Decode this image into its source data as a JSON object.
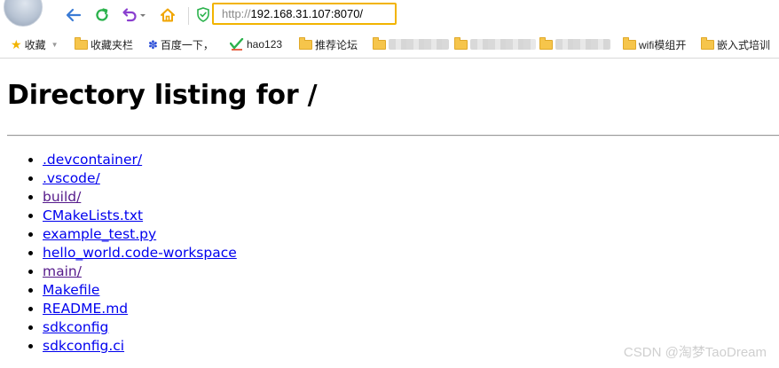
{
  "toolbar": {
    "url_scheme": "http://",
    "url_host": "192.168.31.107:8070/"
  },
  "bookmarks": {
    "items": [
      {
        "label": "收藏",
        "icon": "star-icon"
      },
      {
        "label": "收藏夹栏",
        "icon": "folder-icon"
      },
      {
        "label": "百度一下，",
        "icon": "baidu-paw-icon"
      },
      {
        "label": "hao123",
        "icon": "hao123-icon"
      },
      {
        "label": "推荐论坛",
        "icon": "folder-icon"
      },
      {
        "label": "",
        "icon": "folder-icon"
      },
      {
        "label": "",
        "icon": "folder-icon"
      },
      {
        "label": "",
        "icon": "folder-icon"
      },
      {
        "label": "wifi模组开",
        "icon": "folder-icon"
      },
      {
        "label": "嵌入式培训",
        "icon": "folder-icon"
      }
    ]
  },
  "page": {
    "title": "Directory listing for /",
    "files": [
      {
        "name": ".devcontainer/",
        "visited": false
      },
      {
        "name": ".vscode/",
        "visited": false
      },
      {
        "name": "build/",
        "visited": true
      },
      {
        "name": "CMakeLists.txt",
        "visited": false
      },
      {
        "name": "example_test.py",
        "visited": false
      },
      {
        "name": "hello_world.code-workspace",
        "visited": false
      },
      {
        "name": "main/",
        "visited": true
      },
      {
        "name": "Makefile",
        "visited": false
      },
      {
        "name": "README.md",
        "visited": false
      },
      {
        "name": "sdkconfig",
        "visited": false
      },
      {
        "name": "sdkconfig.ci",
        "visited": false
      }
    ]
  },
  "watermark": "CSDN @淘梦TaoDream",
  "colors": {
    "address_highlight": "#f2b400",
    "link": "#0000ee",
    "visited_link": "#551a8b",
    "back_icon": "#3a7bd5",
    "refresh_icon": "#2bb24c",
    "undo_icon": "#8a3fcf",
    "home_icon": "#f0a500"
  }
}
